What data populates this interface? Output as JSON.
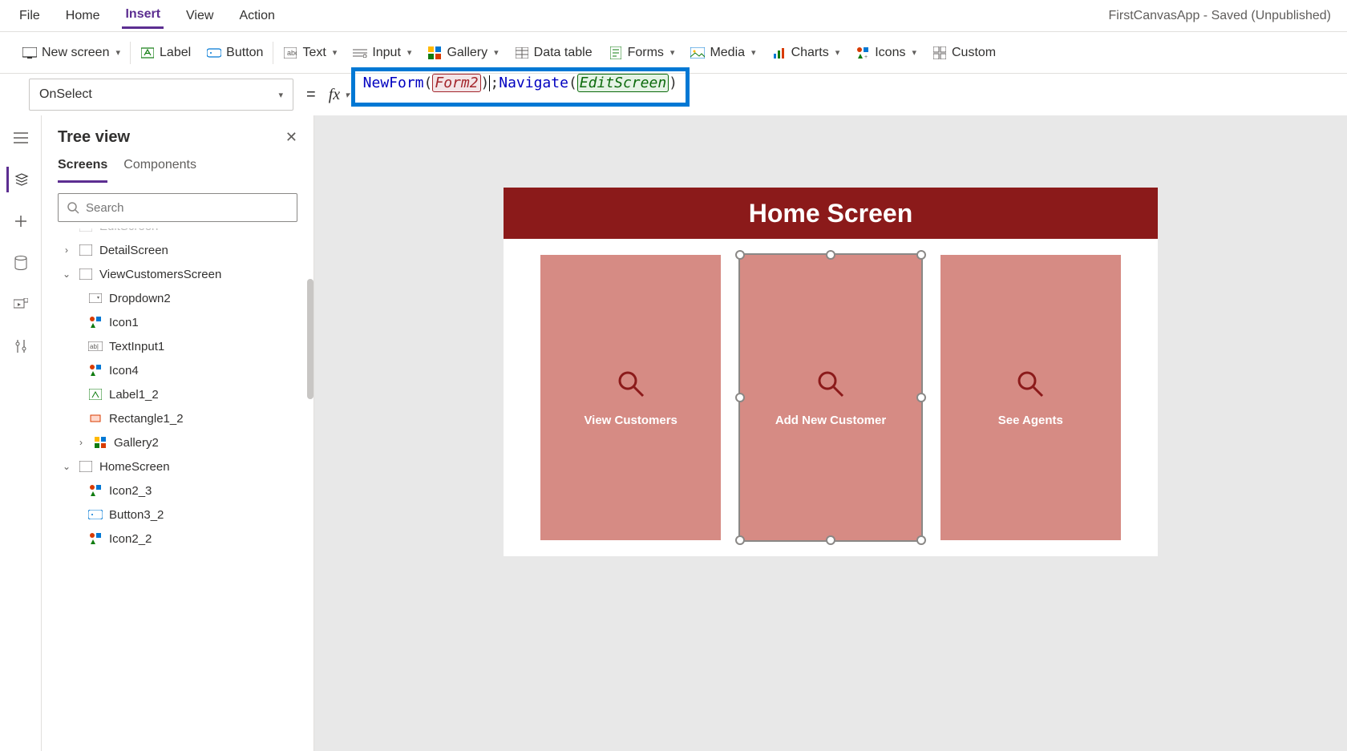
{
  "app_title": "FirstCanvasApp - Saved (Unpublished)",
  "menubar": {
    "items": [
      "File",
      "Home",
      "Insert",
      "View",
      "Action"
    ],
    "active": "Insert"
  },
  "ribbon": {
    "new_screen": "New screen",
    "label": "Label",
    "button": "Button",
    "text": "Text",
    "input": "Input",
    "gallery": "Gallery",
    "data_table": "Data table",
    "forms": "Forms",
    "media": "Media",
    "charts": "Charts",
    "icons": "Icons",
    "custom": "Custom"
  },
  "formula": {
    "property": "OnSelect",
    "fn1": "NewForm",
    "arg1": "Form2",
    "fn2": "Navigate",
    "arg2": "EditScreen"
  },
  "treeview": {
    "title": "Tree view",
    "tabs": [
      "Screens",
      "Components"
    ],
    "active_tab": "Screens",
    "search_placeholder": "Search",
    "nodes": [
      {
        "label": "EditScreen",
        "indent": 1,
        "chev": ">",
        "icon": "screen"
      },
      {
        "label": "DetailScreen",
        "indent": 1,
        "chev": ">",
        "icon": "screen"
      },
      {
        "label": "ViewCustomersScreen",
        "indent": 1,
        "chev": "v",
        "icon": "screen"
      },
      {
        "label": "Dropdown2",
        "indent": 2,
        "icon": "dropdown"
      },
      {
        "label": "Icon1",
        "indent": 2,
        "icon": "icons"
      },
      {
        "label": "TextInput1",
        "indent": 2,
        "icon": "textinput"
      },
      {
        "label": "Icon4",
        "indent": 2,
        "icon": "icons"
      },
      {
        "label": "Label1_2",
        "indent": 2,
        "icon": "label"
      },
      {
        "label": "Rectangle1_2",
        "indent": 2,
        "icon": "rect"
      },
      {
        "label": "Gallery2",
        "indent": 2,
        "chev": ">",
        "icon": "gallery",
        "sub": true
      },
      {
        "label": "HomeScreen",
        "indent": 1,
        "chev": "v",
        "icon": "screen"
      },
      {
        "label": "Icon2_3",
        "indent": 2,
        "icon": "icons"
      },
      {
        "label": "Button3_2",
        "indent": 2,
        "icon": "button"
      },
      {
        "label": "Icon2_2",
        "indent": 2,
        "icon": "icons"
      }
    ]
  },
  "canvas": {
    "header": "Home Screen",
    "cards": [
      {
        "label": "View Customers"
      },
      {
        "label": "Add New Customer",
        "selected": true
      },
      {
        "label": "See Agents"
      }
    ]
  }
}
